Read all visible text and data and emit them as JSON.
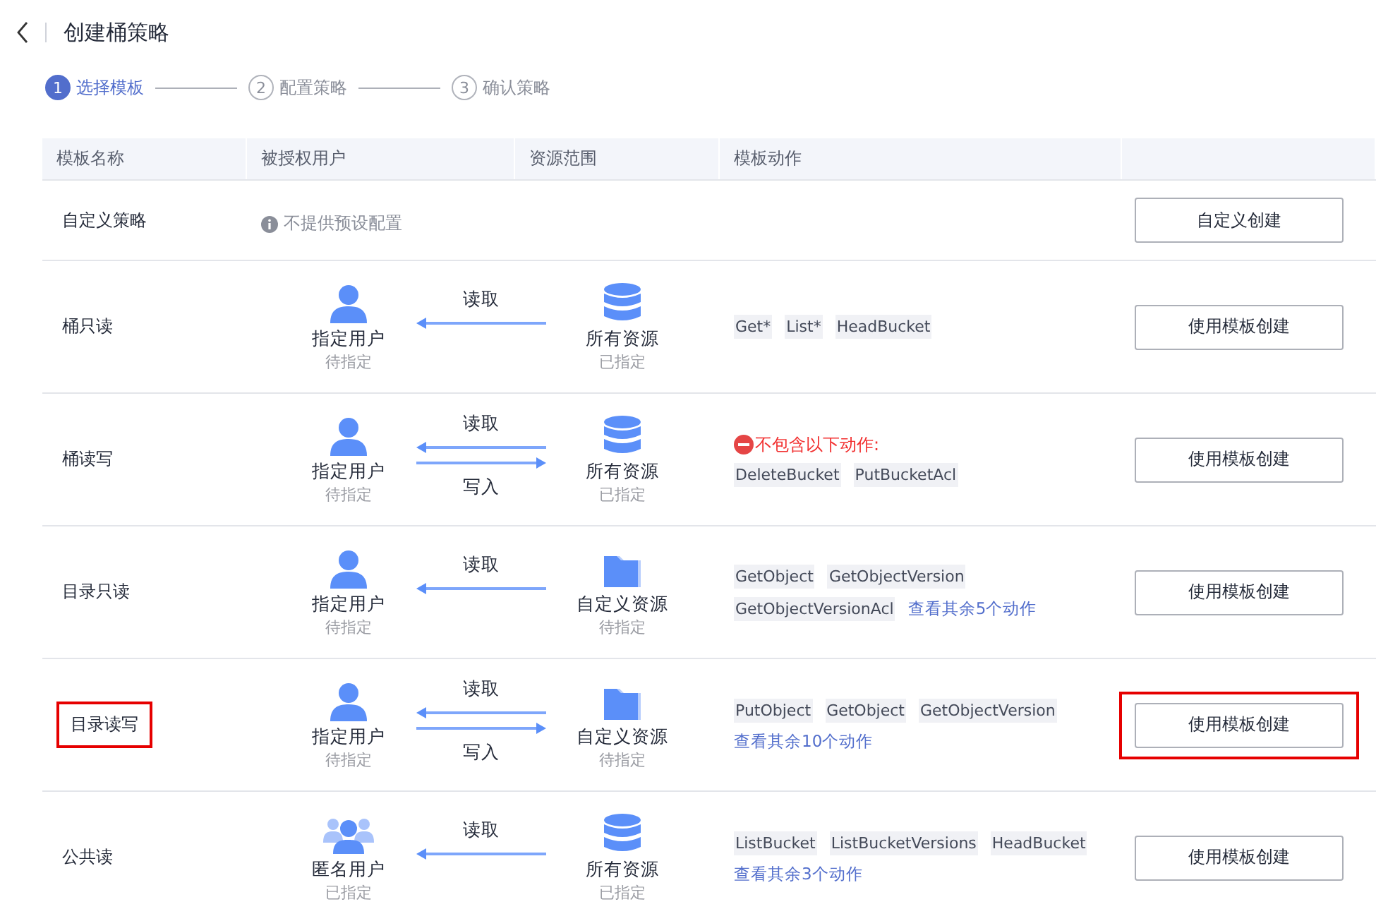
{
  "header": {
    "title": "创建桶策略"
  },
  "steps": [
    {
      "number": "1",
      "label": "选择模板",
      "selected": true
    },
    {
      "number": "2",
      "label": "配置策略",
      "selected": false
    },
    {
      "number": "3",
      "label": "确认策略",
      "selected": false
    }
  ],
  "table": {
    "columns": [
      "模板名称",
      "被授权用户",
      "资源范围",
      "模板动作"
    ],
    "rows": [
      {
        "kind": "custom",
        "name": "自定义策略",
        "highlighted": false,
        "note": "不提供预设配置",
        "button": {
          "label": "自定义创建",
          "highlighted": false
        }
      },
      {
        "kind": "template",
        "name": "桶只读",
        "highlighted": false,
        "user": {
          "kind": "named",
          "label": "指定用户",
          "status": "待指定"
        },
        "flows": [
          {
            "label": "读取",
            "kind": "read"
          }
        ],
        "resource": {
          "kind": "bucket",
          "label": "所有资源",
          "status": "已指定"
        },
        "actions": {
          "tags": [
            "Get*",
            "List*",
            "HeadBucket"
          ]
        },
        "button": {
          "label": "使用模板创建",
          "highlighted": false
        }
      },
      {
        "kind": "template",
        "name": "桶读写",
        "highlighted": false,
        "user": {
          "kind": "named",
          "label": "指定用户",
          "status": "待指定"
        },
        "flows": [
          {
            "label": "读取",
            "kind": "read"
          },
          {
            "label": "写入",
            "kind": "write"
          }
        ],
        "resource": {
          "kind": "bucket",
          "label": "所有资源",
          "status": "已指定"
        },
        "actions": {
          "warning": "不包含以下动作:",
          "tags": [
            "DeleteBucket",
            "PutBucketAcl"
          ]
        },
        "button": {
          "label": "使用模板创建",
          "highlighted": false
        }
      },
      {
        "kind": "template",
        "name": "目录只读",
        "highlighted": false,
        "user": {
          "kind": "named",
          "label": "指定用户",
          "status": "待指定"
        },
        "flows": [
          {
            "label": "读取",
            "kind": "read"
          }
        ],
        "resource": {
          "kind": "directory",
          "label": "自定义资源",
          "status": "待指定"
        },
        "actions": {
          "tags": [
            "GetObject",
            "GetObjectVersion",
            "GetObjectVersionAcl"
          ],
          "more": "查看其余5个动作"
        },
        "button": {
          "label": "使用模板创建",
          "highlighted": false
        }
      },
      {
        "kind": "template",
        "name": "目录读写",
        "highlighted": true,
        "user": {
          "kind": "named",
          "label": "指定用户",
          "status": "待指定"
        },
        "flows": [
          {
            "label": "读取",
            "kind": "read"
          },
          {
            "label": "写入",
            "kind": "write"
          }
        ],
        "resource": {
          "kind": "directory",
          "label": "自定义资源",
          "status": "待指定"
        },
        "actions": {
          "tags": [
            "PutObject",
            "GetObject",
            "GetObjectVersion"
          ],
          "more": "查看其余10个动作"
        },
        "button": {
          "label": "使用模板创建",
          "highlighted": true
        }
      },
      {
        "kind": "template",
        "name": "公共读",
        "highlighted": false,
        "user": {
          "kind": "anonymous",
          "label": "匿名用户",
          "status": "已指定"
        },
        "flows": [
          {
            "label": "读取",
            "kind": "read"
          }
        ],
        "resource": {
          "kind": "bucket",
          "label": "所有资源",
          "status": "已指定"
        },
        "actions": {
          "tags": [
            "ListBucket",
            "ListBucketVersions",
            "HeadBucket"
          ],
          "more": "查看其余3个动作"
        },
        "button": {
          "label": "使用模板创建",
          "highlighted": false
        }
      }
    ]
  }
}
